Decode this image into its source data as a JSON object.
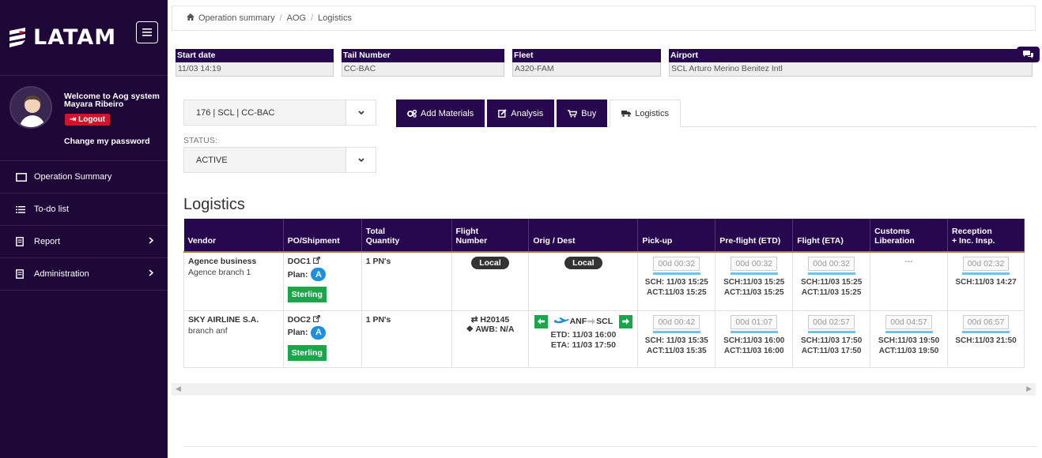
{
  "brand": {
    "name": "LATAM"
  },
  "profile": {
    "welcome": "Welcome to Aog system",
    "user": "Mayara Ribeiro",
    "logout": "Logout",
    "change_password": "Change my password"
  },
  "nav": [
    {
      "label": "Operation Summary",
      "icon": "monitor-icon"
    },
    {
      "label": "To-do list",
      "icon": "list-icon"
    },
    {
      "label": "Report",
      "icon": "document-icon"
    },
    {
      "label": "Administration",
      "icon": "document-icon"
    }
  ],
  "breadcrumb": {
    "home": "Operation summary",
    "mid": "AOG",
    "current": "Logistics"
  },
  "header": {
    "start_date_label": "Start date",
    "start_date": "11/03 14:19",
    "tail_label": "Tail Number",
    "tail": "CC-BAC",
    "fleet_label": "Fleet",
    "fleet": "A320-FAM",
    "airport_label": "Airport",
    "airport": "SCL Arturo Merino Benitez Intl"
  },
  "selectors": {
    "aog": "176 | SCL | CC-BAC",
    "status_label": "STATUS:",
    "status": "ACTIVE"
  },
  "tabs": [
    {
      "label": "Add Materials"
    },
    {
      "label": "Analysis"
    },
    {
      "label": "Buy"
    },
    {
      "label": "Logistics"
    }
  ],
  "section_title": "Logistics",
  "table": {
    "headers": {
      "vendor": "Vendor",
      "po": "PO/Shipment",
      "qty1": "Total",
      "qty2": "Quantity",
      "flight1": "Flight",
      "flight2": "Number",
      "orig": "Orig / Dest",
      "pickup": "Pick-up",
      "preflight": "Pre-flight (ETD)",
      "flight_eta": "Flight (ETA)",
      "customs1": "Customs",
      "customs2": "Liberation",
      "reception1": "Reception",
      "reception2": "+ Inc. Insp."
    },
    "rows": [
      {
        "vendor": "Agence business",
        "branch": "Agence branch 1",
        "doc": "DOC1",
        "plan": "Plan:",
        "plan_badge": "A",
        "carrier": "Sterling",
        "qty": "1 PN's",
        "flight_local": "Local",
        "orig_local": "Local",
        "pickup": {
          "timer": "00d 00:32",
          "sch": "SCH: 11/03 15:25",
          "act": "ACT:11/03 15:25"
        },
        "preflight": {
          "timer": "00d 00:32",
          "sch": "SCH:11/03 15:25",
          "act": "ACT:11/03 15:25"
        },
        "flight_eta": {
          "timer": "00d 00:32",
          "sch": "SCH:11/03 15:25",
          "act": "ACT:11/03 15:25"
        },
        "customs": "---",
        "reception": {
          "timer": "00d 02:32",
          "sch": "SCH:11/03 14:27"
        }
      },
      {
        "vendor": "SKY AIRLINE S.A.",
        "branch": "branch anf",
        "doc": "DOC2",
        "plan": "Plan:",
        "plan_badge": "A",
        "carrier": "Sterling",
        "qty": "1 PN's",
        "flight_no": "H20145",
        "awb": "AWB: N/A",
        "orig": "ANF",
        "dest": "SCL",
        "etd": "ETD: 11/03 16:00",
        "eta": "ETA: 11/03 17:50",
        "pickup": {
          "timer": "00d 00:42",
          "sch": "SCH: 11/03 15:35",
          "act": "ACT:11/03 15:35"
        },
        "preflight": {
          "timer": "00d 01:07",
          "sch": "SCH:11/03 16:00",
          "act": "ACT:11/03 16:00"
        },
        "flight_eta": {
          "timer": "00d 02:57",
          "sch": "SCH:11/03 17:50",
          "act": "ACT:11/03 17:50"
        },
        "customs": {
          "timer": "00d 04:57",
          "sch": "SCH:11/03 19:50",
          "act": "ACT:11/03 19:50"
        },
        "reception": {
          "timer": "00d 06:57",
          "sch": "SCH:11/03 21:50"
        }
      }
    ]
  },
  "colors": {
    "brand_purple": "#27084f",
    "sidebar": "#1e0838",
    "green": "#18a84a",
    "blue_badge": "#1b8fe0",
    "logout_red": "#d0142c"
  }
}
